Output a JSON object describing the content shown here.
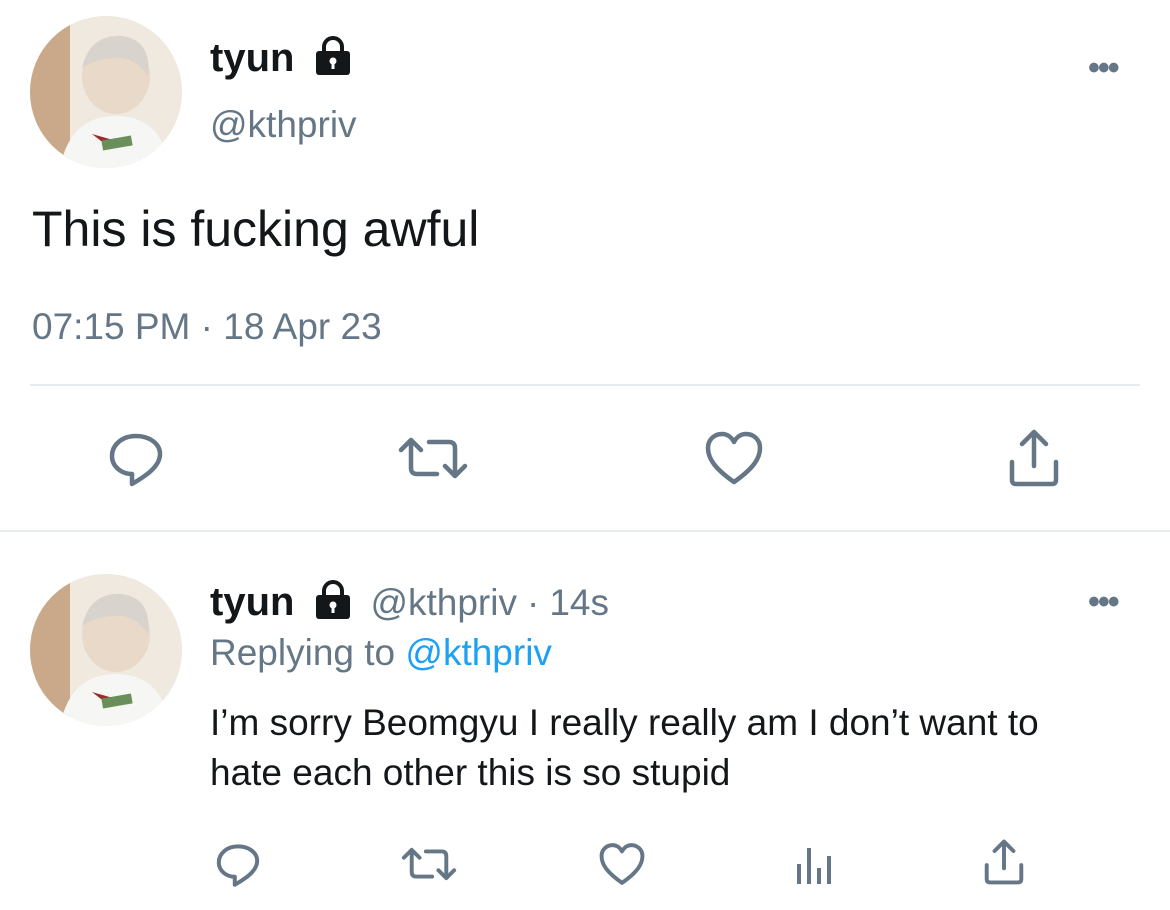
{
  "main_tweet": {
    "name": "tyun",
    "handle": "@kthpriv",
    "text": "This is fucking awful",
    "timestamp": "07:15 PM · 18 Apr 23",
    "more": "•••"
  },
  "reply_tweet": {
    "name": "tyun",
    "handle": "@kthpriv",
    "separator": "·",
    "age": "14s",
    "replying_prefix": "Replying to",
    "replying_handle": "@kthpriv",
    "text": "I’m sorry Beomgyu I really really am I don’t want to hate each other this is so stupid",
    "more": "•••"
  },
  "icons": {
    "main_actions": [
      "reply-icon",
      "retweet-icon",
      "like-icon",
      "share-icon"
    ],
    "reply_actions": [
      "reply-icon",
      "retweet-icon",
      "like-icon",
      "analytics-icon",
      "share-icon"
    ]
  },
  "colors": {
    "text": "#14171a",
    "secondary": "#657786",
    "link": "#1da1f2",
    "divider": "#e6ecf0"
  }
}
